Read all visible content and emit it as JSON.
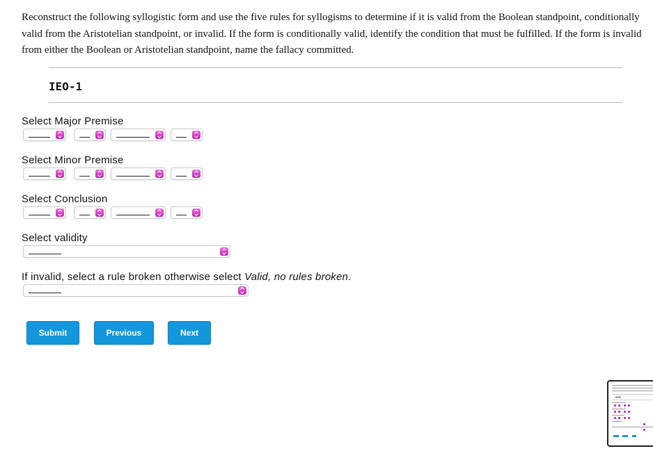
{
  "instructions": "Reconstruct the following syllogistic form and use the five rules for syllogisms to determine if it is valid from the Boolean standpoint, conditionally valid from the Aristotelian standpoint, or invalid. If the form is conditionally valid, identify the condition that must be fulfilled. If the form is invalid from either the Boolean or Aristotelian standpoint, name the fallacy committed.",
  "form_code": "IEO-1",
  "major_premise": {
    "label": "Select Major Premise",
    "values": [
      "",
      "",
      "",
      ""
    ]
  },
  "minor_premise": {
    "label": "Select Minor Premise",
    "values": [
      "",
      "",
      "",
      ""
    ]
  },
  "conclusion": {
    "label": "Select Conclusion",
    "values": [
      "",
      "",
      "",
      ""
    ]
  },
  "validity": {
    "label": "Select validity",
    "value": ""
  },
  "rule": {
    "label_prefix": "If invalid, select a rule broken otherwise select ",
    "label_emph": "Valid, no rules broken",
    "label_suffix": ".",
    "value": ""
  },
  "buttons": {
    "submit": "Submit",
    "previous": "Previous",
    "next": "Next"
  },
  "colors": {
    "button": "#1296dc",
    "select_knob": "#c025b0"
  }
}
